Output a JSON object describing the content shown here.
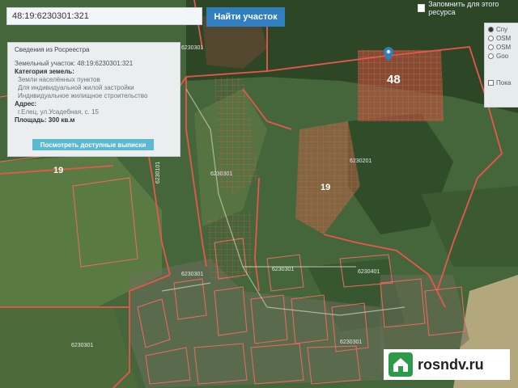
{
  "search": {
    "value": "48:19:6230301:321"
  },
  "find_button": "Найти участок",
  "remember_label": "Запомнить для этого ресурса",
  "info": {
    "header": "Сведения из Росреестра",
    "parcel_line": "Земельный участок: 48:19:6230301:321",
    "category_label": "Категория земель:",
    "category_value": "Земли населённых пунктов",
    "use_line1": "Для индивидуальной жилой застройки",
    "use_line2": "Индивидуальное жилищное строительство",
    "address_label": "Адрес:",
    "address_value": "г.Елец, ул.Усадебная, с. 15",
    "area_line": "Площадь: 300 кв.м",
    "extract_button": "Посмотреть доступные выписки"
  },
  "layers": {
    "options": [
      "Спу",
      "OSM",
      "OSM",
      "Goo"
    ],
    "checkbox_label": "Пока"
  },
  "map_labels": {
    "big48": "48",
    "label19a": "19",
    "label19b": "19",
    "small": [
      "6230301",
      "6230201",
      "6230401",
      "6230301",
      "6230301",
      "6230301",
      "6230301",
      "6230301",
      "6230101"
    ]
  },
  "watermark": "rosndv.ru",
  "colors": {
    "accent": "#2f7fc1",
    "parcel": "#e0524a",
    "extract": "#5bbad1",
    "brand": "#2d9a49"
  }
}
